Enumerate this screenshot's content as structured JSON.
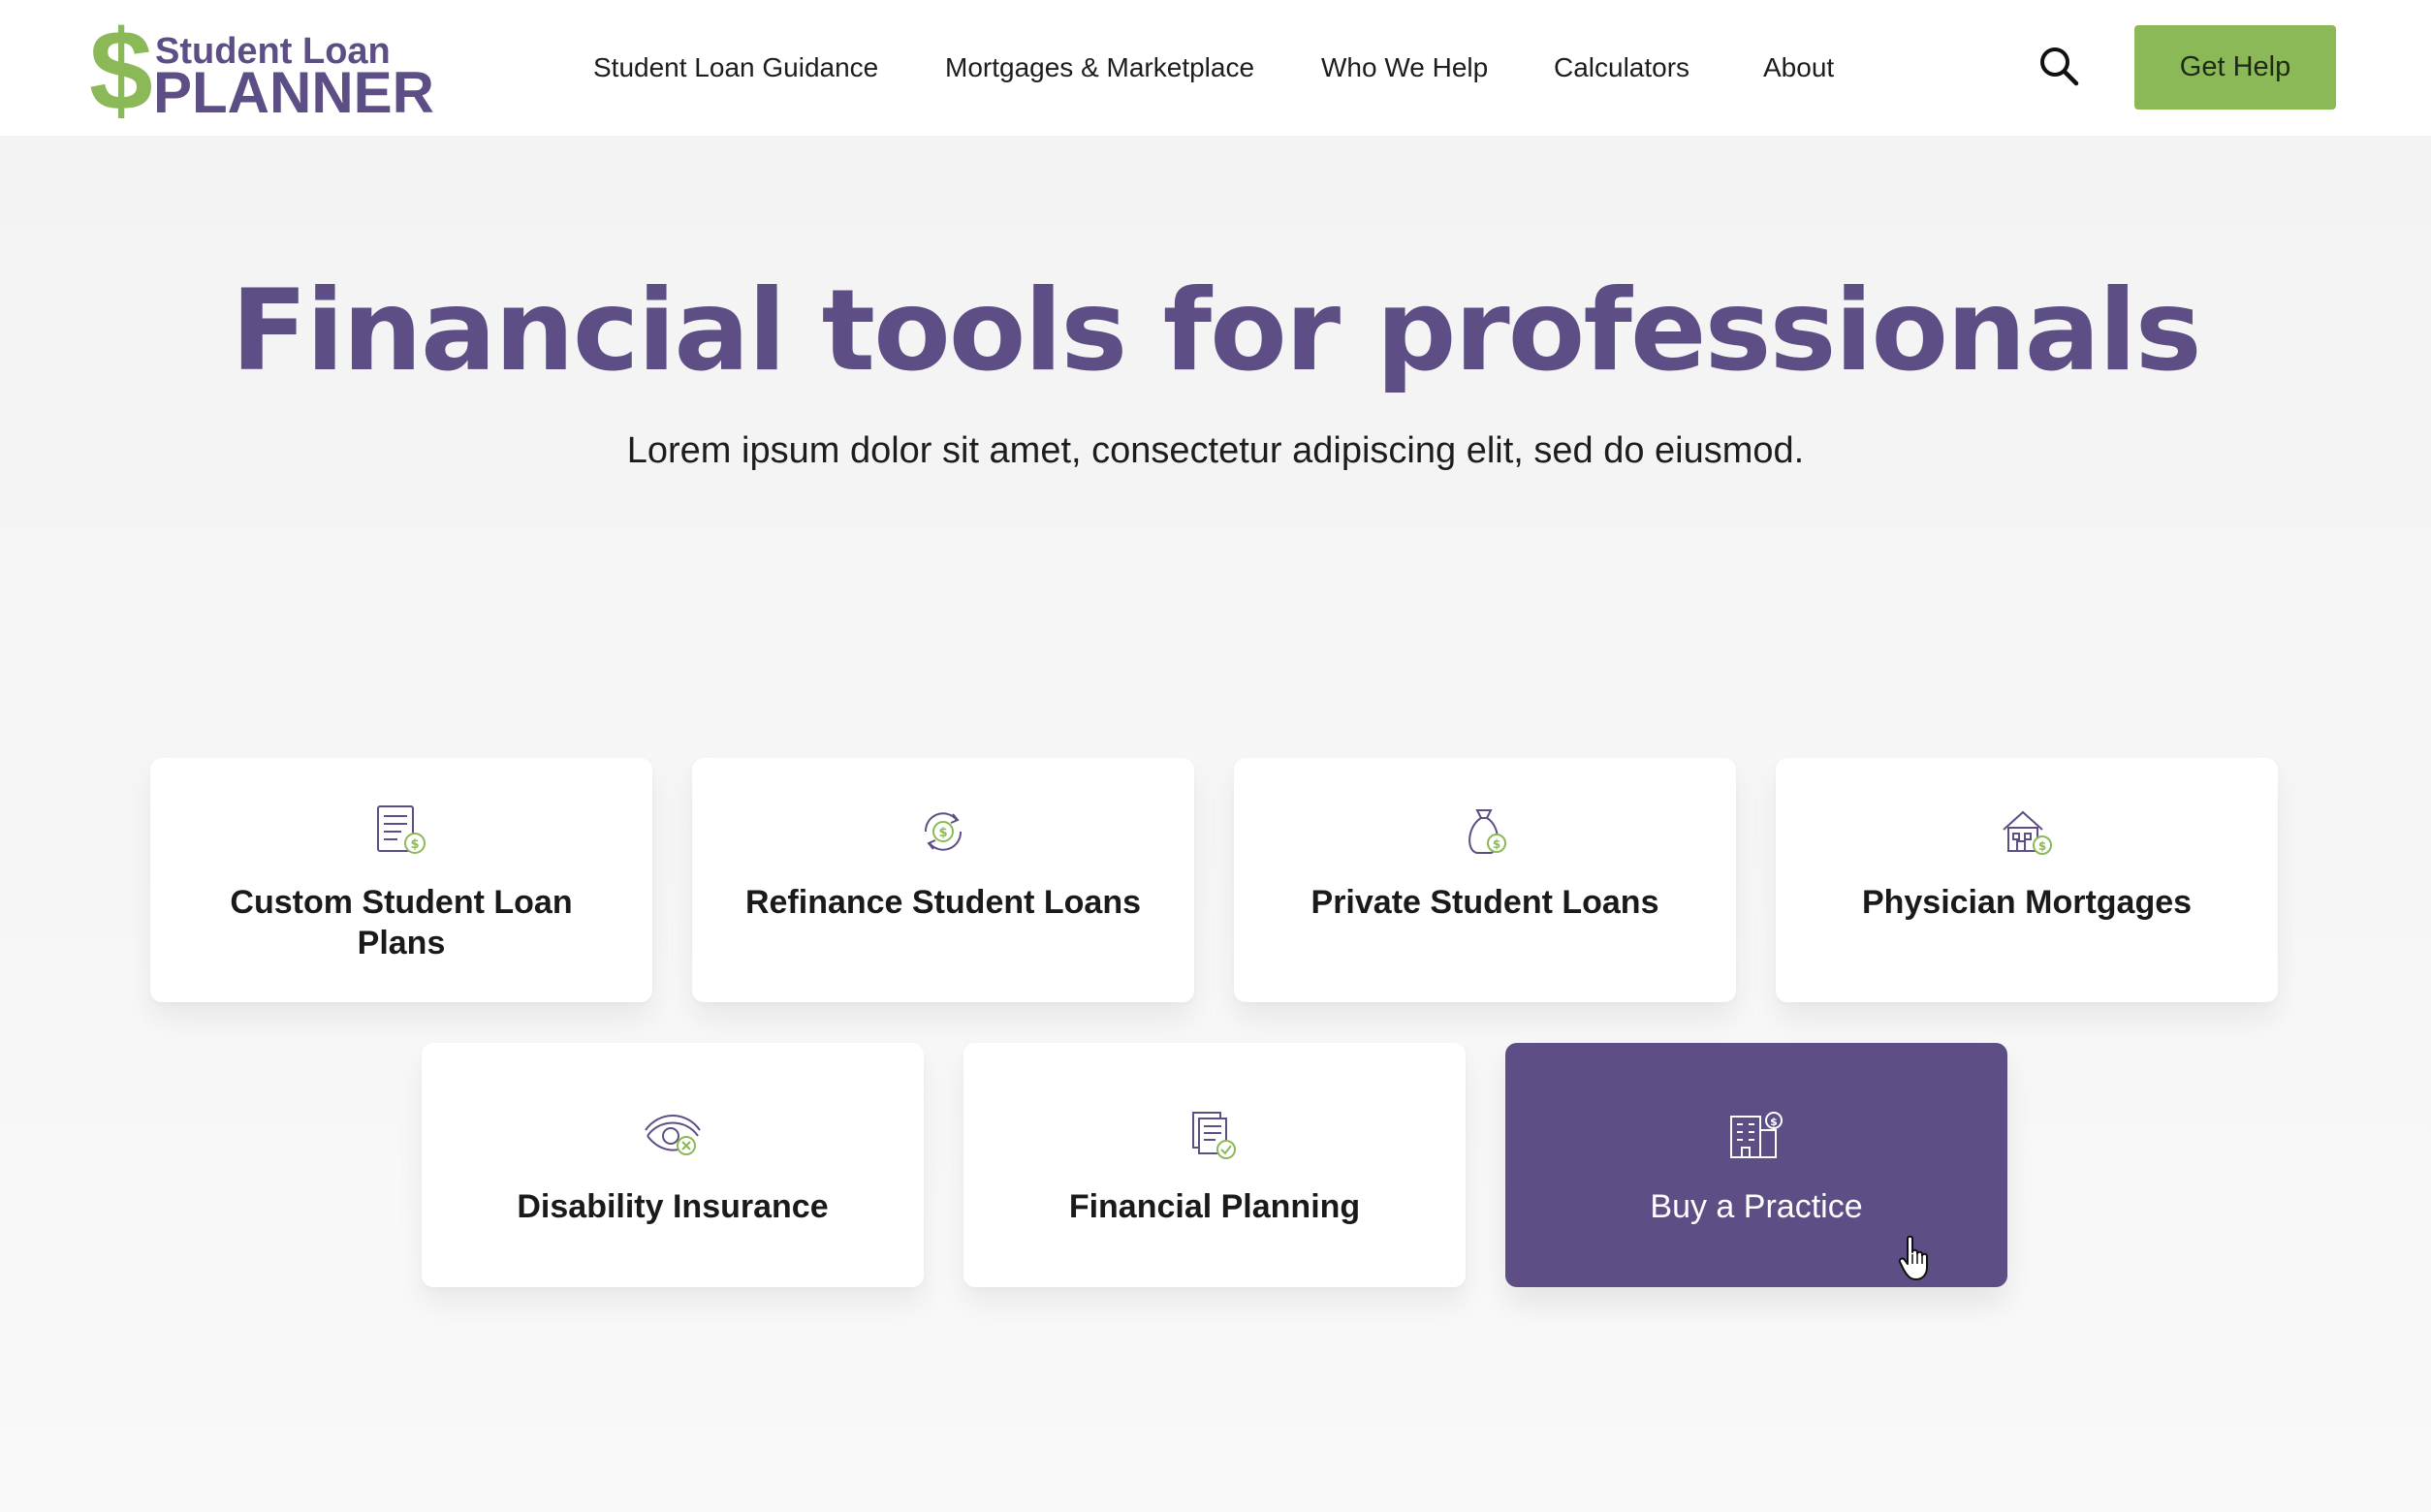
{
  "logo": {
    "symbol": "$",
    "line1": "Student Loan",
    "line2": "PLANNER"
  },
  "nav": {
    "items": [
      {
        "label": "Student Loan Guidance"
      },
      {
        "label": "Mortgages & Marketplace"
      },
      {
        "label": "Who We Help"
      },
      {
        "label": "Calculators"
      },
      {
        "label": "About"
      }
    ]
  },
  "header": {
    "search_icon": "search-icon",
    "cta_label": "Get Help"
  },
  "hero": {
    "title": "Financial tools for professionals",
    "subtitle": "Lorem ipsum dolor sit amet, consectetur adipiscing elit, sed do eiusmod."
  },
  "cards": [
    {
      "label": "Custom Student Loan Plans",
      "icon": "document-dollar-icon"
    },
    {
      "label": "Refinance Student Loans",
      "icon": "refresh-dollar-icon"
    },
    {
      "label": "Private Student Loans",
      "icon": "money-bag-icon"
    },
    {
      "label": "Physician Mortgages",
      "icon": "house-dollar-icon"
    },
    {
      "label": "Disability Insurance",
      "icon": "eye-shield-icon"
    },
    {
      "label": "Financial Planning",
      "icon": "documents-check-icon"
    },
    {
      "label": "Buy a Practice",
      "icon": "building-dollar-icon",
      "state": "hovered"
    }
  ],
  "colors": {
    "brand_purple": "#5d4e85",
    "brand_green": "#8cb957",
    "background": "#f4f4f4",
    "card": "#ffffff"
  }
}
